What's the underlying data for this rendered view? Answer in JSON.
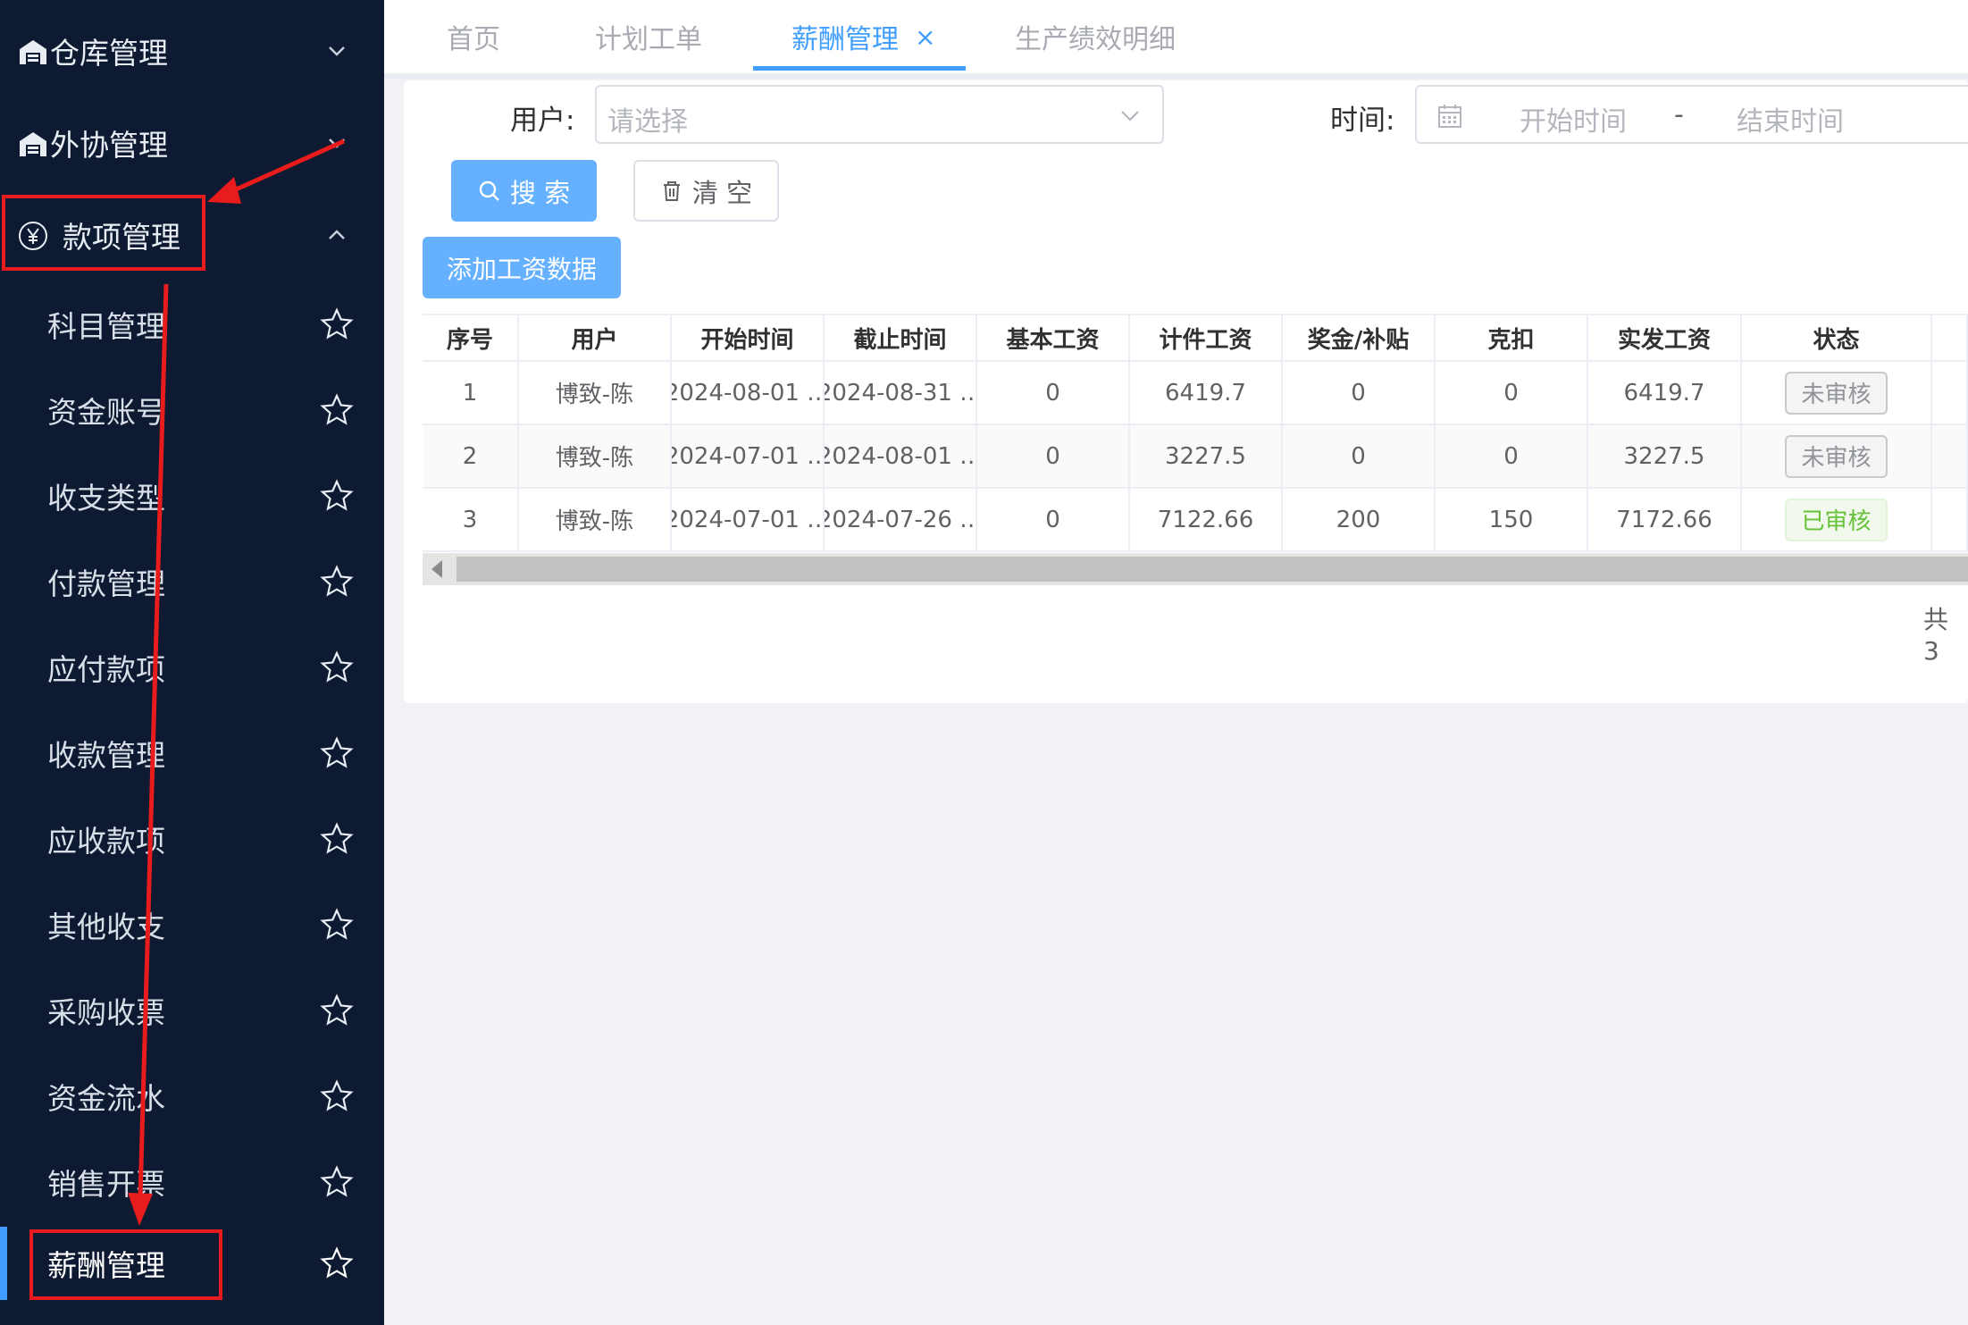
{
  "sidebar": {
    "groups": [
      {
        "label": "仓库管理",
        "icon": "warehouse-icon",
        "expanded": false
      },
      {
        "label": "外协管理",
        "icon": "warehouse-icon",
        "expanded": false
      },
      {
        "label": "款项管理",
        "icon": "yen-icon",
        "expanded": true
      }
    ],
    "items": [
      {
        "label": "科目管理"
      },
      {
        "label": "资金账号"
      },
      {
        "label": "收支类型"
      },
      {
        "label": "付款管理"
      },
      {
        "label": "应付款项"
      },
      {
        "label": "收款管理"
      },
      {
        "label": "应收款项"
      },
      {
        "label": "其他收支"
      },
      {
        "label": "采购收票"
      },
      {
        "label": "资金流水"
      },
      {
        "label": "销售开票"
      },
      {
        "label": "薪酬管理",
        "active": true
      }
    ]
  },
  "tabs": [
    {
      "label": "首页"
    },
    {
      "label": "计划工单"
    },
    {
      "label": "薪酬管理",
      "active": true,
      "close": "×"
    },
    {
      "label": "生产绩效明细"
    }
  ],
  "filters": {
    "user_label": "用户:",
    "user_placeholder": "请选择",
    "time_label": "时间:",
    "start_placeholder": "开始时间",
    "range_separator": "-",
    "end_placeholder": "结束时间"
  },
  "buttons": {
    "search": "搜 索",
    "clear": "清 空",
    "add": "添加工资数据"
  },
  "table": {
    "headers": [
      "序号",
      "用户",
      "开始时间",
      "截止时间",
      "基本工资",
      "计件工资",
      "奖金/补贴",
      "克扣",
      "实发工资",
      "状态"
    ],
    "rows": [
      {
        "index": "1",
        "user": "博致-陈",
        "start": "2024-08-01 …",
        "end": "2024-08-31 …",
        "base": "0",
        "piece": "6419.7",
        "bonus": "0",
        "deduct": "0",
        "actual": "6419.7",
        "status": "未审核"
      },
      {
        "index": "2",
        "user": "博致-陈",
        "start": "2024-07-01 …",
        "end": "2024-08-01 …",
        "base": "0",
        "piece": "3227.5",
        "bonus": "0",
        "deduct": "0",
        "actual": "3227.5",
        "status": "未审核"
      },
      {
        "index": "3",
        "user": "博致-陈",
        "start": "2024-07-01 …",
        "end": "2024-07-26 …",
        "base": "0",
        "piece": "7122.66",
        "bonus": "200",
        "deduct": "150",
        "actual": "7172.66",
        "status": "已审核"
      }
    ]
  },
  "pagination": {
    "total_text": "共 3"
  },
  "colors": {
    "sidebar_bg": "#0e1a31",
    "primary": "#409eff",
    "button_light": "#66b1ff",
    "annotation": "#e81c1c",
    "reviewed": "#67c23a"
  }
}
